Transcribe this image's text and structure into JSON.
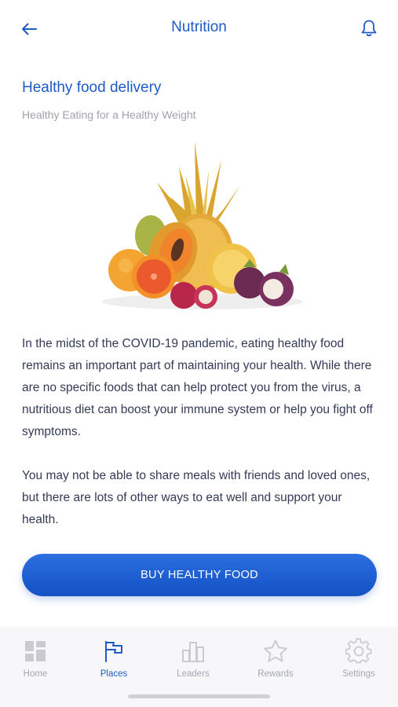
{
  "header": {
    "title": "Nutrition",
    "back_icon": "arrow-left-icon",
    "notification_icon": "bell-icon"
  },
  "content": {
    "section_title": "Healthy food delivery",
    "subtitle": "Healthy Eating for a Healthy Weight",
    "illustration": "fruit-pile-illustration",
    "paragraphs": [
      "In the midst of the COVID-19 pandemic, eating healthy food remains an important part of maintaining your health. While there are no specific foods that can help protect you from the virus, a nutritious diet can boost your immune system or help you fight off symptoms.",
      "You may not be able to share meals with friends and loved ones, but there are lots of other ways to eat well and support your health."
    ],
    "cta_label": "BUY HEALTHY FOOD"
  },
  "tabbar": {
    "items": [
      {
        "label": "Home",
        "icon": "grid-icon",
        "active": false
      },
      {
        "label": "Places",
        "icon": "flag-icon",
        "active": true
      },
      {
        "label": "Leaders",
        "icon": "bar-chart-icon",
        "active": false
      },
      {
        "label": "Rewards",
        "icon": "star-icon",
        "active": false
      },
      {
        "label": "Settings",
        "icon": "gear-icon",
        "active": false
      }
    ]
  },
  "colors": {
    "accent": "#1e5bc6",
    "inactive": "#a4a7b0",
    "body_text": "#333a56",
    "button_top": "#2b6fe0",
    "button_bottom": "#1451c4"
  }
}
